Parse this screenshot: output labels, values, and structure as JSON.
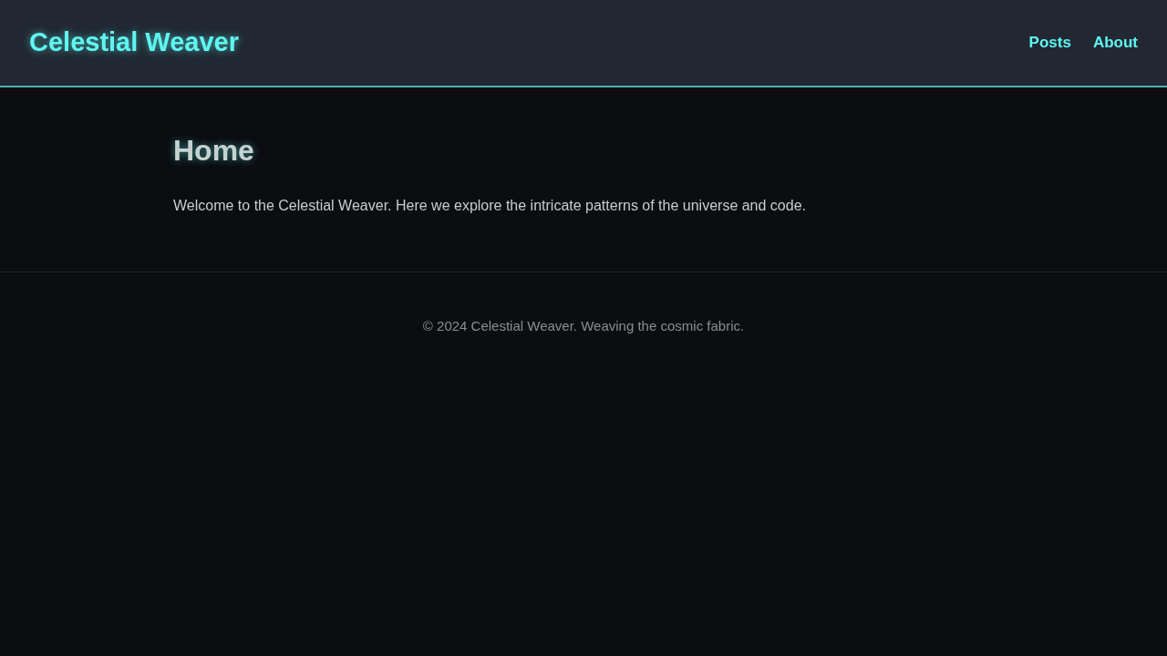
{
  "header": {
    "site_title": "Celestial Weaver",
    "nav": [
      {
        "label": "Posts"
      },
      {
        "label": "About"
      }
    ]
  },
  "main": {
    "heading": "Home",
    "paragraph": "Welcome to the Celestial Weaver. Here we explore the intricate patterns of the universe and code."
  },
  "footer": {
    "text": "© 2024 Celestial Weaver. Weaving the cosmic fabric."
  }
}
